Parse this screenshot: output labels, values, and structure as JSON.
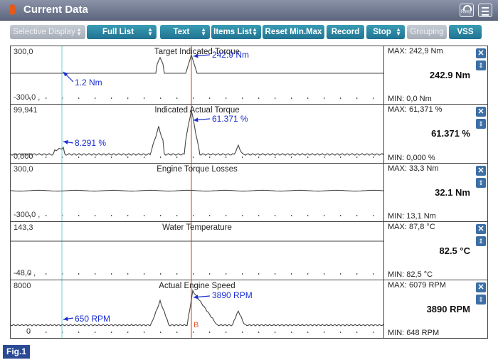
{
  "window": {
    "title": "Current Data",
    "retry_label": "Retry"
  },
  "toolbar": [
    {
      "label": "Selective Display",
      "arrows": true,
      "disabled": true
    },
    {
      "label": "Full List",
      "arrows": true,
      "disabled": false
    },
    {
      "label": "Text",
      "arrows": true,
      "disabled": false
    },
    {
      "label": "Items List",
      "arrows": true,
      "disabled": false
    },
    {
      "label": "Reset Min.Max",
      "arrows": false,
      "disabled": false
    },
    {
      "label": "Record",
      "arrows": false,
      "disabled": false
    },
    {
      "label": "Stop",
      "arrows": true,
      "disabled": false
    },
    {
      "label": "Grouping",
      "arrows": false,
      "disabled": true
    },
    {
      "label": "VSS",
      "arrows": false,
      "disabled": false
    }
  ],
  "colors": {
    "accent": "#1f7391",
    "cursor_line": "#e85a2a",
    "marker_line": "#7fd9e3",
    "annotation": "#1a2fd0",
    "figure_badge": "#2a4a95"
  },
  "panels": [
    {
      "title": "Target Indicated Torque",
      "scale_top": "300,0",
      "scale_bottom": "-300,0 ,",
      "max": "MAX: 242,9 Nm",
      "current": "242.9 Nm",
      "min": "MIN: 0,0 Nm",
      "marker_label": "1.2 Nm",
      "cursor_label": "242.9 Nm"
    },
    {
      "title": "Indicated Actual Torque",
      "scale_top": "99,941",
      "scale_bottom": "0,000",
      "max": "MAX: 61,371 %",
      "current": "61.371 %",
      "min": "MIN: 0,000 %",
      "marker_label": "8.291 %",
      "cursor_label": "61.371 %"
    },
    {
      "title": "Engine Torque Losses",
      "scale_top": "300,0",
      "scale_bottom": "-300,0 ,",
      "max": "MAX: 33,3 Nm",
      "current": "32.1 Nm",
      "min": "MIN: 13,1 Nm"
    },
    {
      "title": "Water Temperature",
      "scale_top": "143,3",
      "scale_bottom": "-48,0 ,",
      "max": "MAX: 87,8 °C",
      "current": "82.5 °C",
      "min": "MIN: 82,5 °C"
    },
    {
      "title": "Actual Engine Speed",
      "scale_top": "8000",
      "scale_bottom": "0",
      "max": "MAX: 6079 RPM",
      "current": "3890 RPM",
      "min": "MIN: 648 RPM",
      "marker_label": "650 RPM",
      "cursor_label": "3890 RPM",
      "cursor_tag": "B"
    }
  ],
  "figure_label": "Fig.1"
}
